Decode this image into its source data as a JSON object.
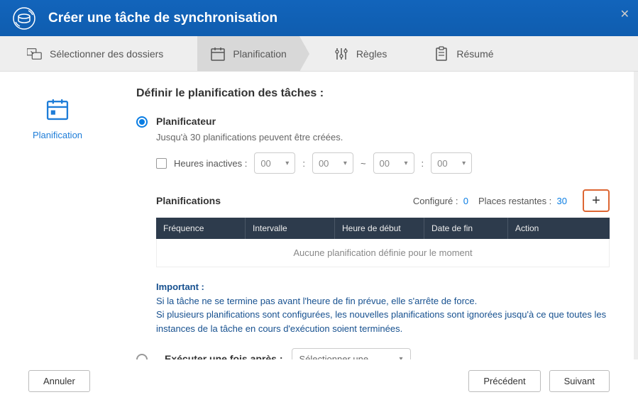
{
  "header": {
    "title": "Créer une tâche de synchronisation"
  },
  "steps": {
    "folders": "Sélectionner des dossiers",
    "schedule": "Planification",
    "rules": "Règles",
    "summary": "Résumé"
  },
  "side": {
    "label": "Planification"
  },
  "main": {
    "title": "Définir le planification des tâches :",
    "planner_label": "Planificateur",
    "planner_sub": "Jusqu'à 30 planifications peuvent être créées.",
    "inactive_label": "Heures inactives :",
    "time_opts": {
      "h1": "00",
      "m1": "00",
      "h2": "00",
      "m2": "00"
    },
    "sched_title": "Planifications",
    "configured_label": "Configuré :",
    "configured_val": "0",
    "remaining_label": "Places restantes :",
    "remaining_val": "30",
    "table": {
      "cols": {
        "freq": "Fréquence",
        "interval": "Intervalle",
        "start": "Heure de début",
        "end": "Date de fin",
        "action": "Action"
      },
      "empty": "Aucune planification définie pour le moment"
    },
    "important_title": "Important :",
    "important_1": "Si la tâche ne se termine pas avant l'heure de fin prévue, elle s'arrête de force.",
    "important_2": "Si plusieurs planifications sont configurées, les nouvelles planifications sont ignorées jusqu'à ce que toutes les instances de la tâche en cours d'exécution soient terminées.",
    "exec_label": "Exécuter une fois après :",
    "exec_placeholder": "Sélectionner une …"
  },
  "footer": {
    "cancel": "Annuler",
    "prev": "Précédent",
    "next": "Suivant"
  }
}
